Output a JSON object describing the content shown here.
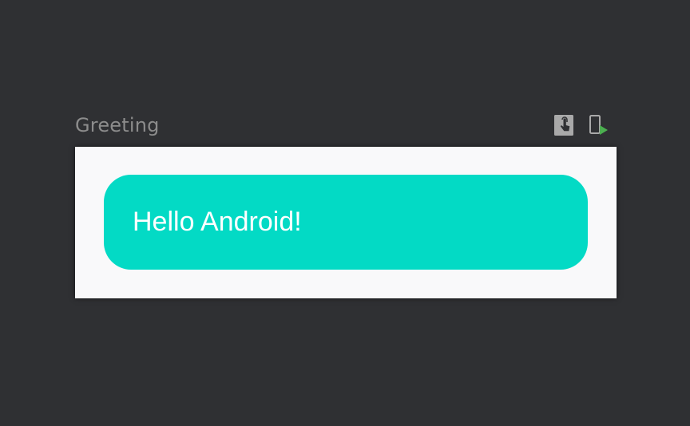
{
  "preview": {
    "title": "Greeting",
    "toolbar": {
      "interactive_icon": "interactive-mode-icon",
      "deploy_icon": "deploy-to-device-icon"
    }
  },
  "composable": {
    "text": "Hello Android!",
    "surface_color": "#03dac5",
    "background_color": "#f9f9fa"
  },
  "colors": {
    "ide_background": "#2f3033",
    "title_color": "#8c8c8c",
    "deploy_accent": "#4caf50"
  }
}
